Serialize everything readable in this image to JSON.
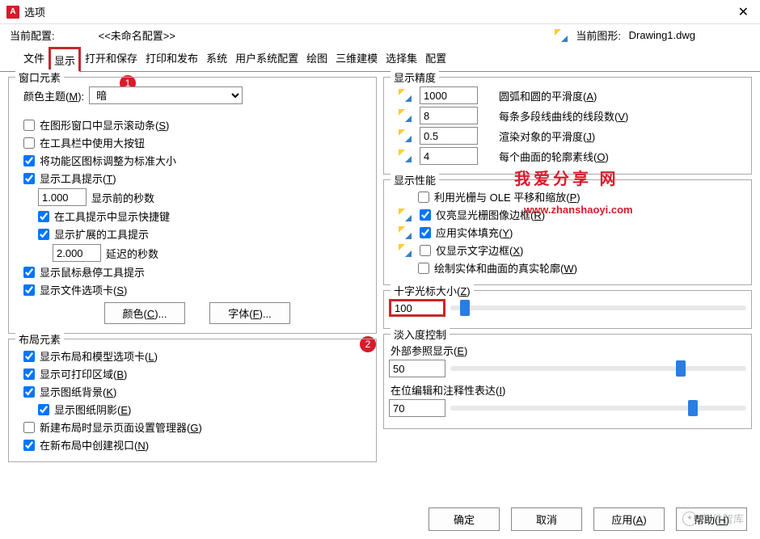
{
  "window": {
    "title": "选项",
    "close": "✕",
    "app_glyph": "A"
  },
  "info": {
    "profile_label": "当前配置:",
    "profile_value": "<<未命名配置>>",
    "drawing_label": "当前图形:",
    "drawing_value": "Drawing1.dwg"
  },
  "tabs": [
    "文件",
    "显示",
    "打开和保存",
    "打印和发布",
    "系统",
    "用户系统配置",
    "绘图",
    "三维建模",
    "选择集",
    "配置"
  ],
  "badges": {
    "one": "1",
    "two": "2"
  },
  "window_elements": {
    "title": "窗口元素",
    "color_theme_label": "颜色主题(<u>M</u>):",
    "color_theme_value": "暗",
    "scroll_bars": "在图形窗口中显示滚动条(<u>S</u>)",
    "large_buttons": "在工具栏中使用大按钮",
    "ribbon_standard": "将功能区图标调整为标准大小",
    "tooltips": "显示工具提示(<u>T</u>)",
    "seconds_to_display": "1.000",
    "seconds_to_display_label": "显示前的秒数",
    "shortcuts": "在工具提示中显示快捷键",
    "extended": "显示扩展的工具提示",
    "delay_seconds": "2.000",
    "delay_seconds_label": "延迟的秒数",
    "rollover": "显示鼠标悬停工具提示",
    "file_tabs": "显示文件选项卡(<u>S</u>)",
    "colors_btn": "颜色(<u>C</u>)...",
    "fonts_btn": "字体(<u>F</u>)..."
  },
  "layout_elements": {
    "title": "布局元素",
    "layout_tabs": "显示布局和模型选项卡(<u>L</u>)",
    "printable": "显示可打印区域(<u>B</u>)",
    "paper_bg": "显示图纸背景(<u>K</u>)",
    "paper_shadow": "显示图纸阴影(<u>E</u>)",
    "page_setup": "新建布局时显示页面设置管理器(<u>G</u>)",
    "viewport": "在新布局中创建视口(<u>N</u>)"
  },
  "display_resolution": {
    "title": "显示精度",
    "arc_value": "1000",
    "arc_label": "圆弧和圆的平滑度(<u>A</u>)",
    "seg_value": "8",
    "seg_label": "每条多段线曲线的线段数(<u>V</u>)",
    "render_value": "0.5",
    "render_label": "渲染对象的平滑度(<u>J</u>)",
    "contour_value": "4",
    "contour_label_prefix": "每个曲面的轮廓素线(<u>O</u>)"
  },
  "display_performance": {
    "title": "显示性能",
    "pan_zoom": "利用光栅与 OLE 平移和缩放(<u>P</u>)",
    "highlight": "仅亮显光栅图像边框(<u>R</u>)",
    "solid_fill": "应用实体填充(<u>Y</u>)",
    "text_frame": "仅显示文字边框(<u>X</u>)",
    "true_sil": "绘制实体和曲面的真实轮廓(<u>W</u>)"
  },
  "crosshair": {
    "title": "十字光标大小(<u>Z</u>)",
    "value": "100"
  },
  "fade": {
    "title": "淡入度控制",
    "xref_label": "外部参照显示(<u>E</u>)",
    "xref_value": "50",
    "edit_label": "在位编辑和注释性表达(<u>I</u>)",
    "edit_value": "70"
  },
  "overlay": {
    "text1": "我爱分享 网",
    "text2": "www.zhanshaoyi.com"
  },
  "footer": {
    "ok": "确定",
    "cancel": "取消",
    "apply": "应用(<u>A</u>)",
    "help": "帮助(<u>H</u>)"
  },
  "watermark": "软件智库"
}
